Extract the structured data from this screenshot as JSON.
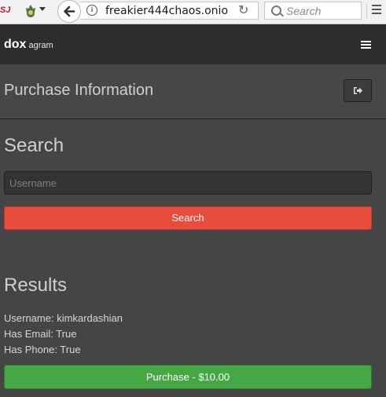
{
  "browser": {
    "ext_label": "SJ",
    "url": "freakier444chaos.onio",
    "search_placeholder": "Search"
  },
  "navbar": {
    "brand": "dox",
    "brand_sub": "agram"
  },
  "header": {
    "title": "Purchase Information"
  },
  "search": {
    "title": "Search",
    "placeholder": "Username",
    "button_label": "Search"
  },
  "results": {
    "title": "Results",
    "username_line": "Username: kimkardashian",
    "email_line": "Has Email: True",
    "phone_line": "Has Phone: True",
    "purchase_label": "Purchase - $10.00"
  },
  "colors": {
    "navbar": "#2d2d2d",
    "background": "#454545",
    "search_button": "#e74c3c",
    "purchase_button": "#45a845"
  }
}
